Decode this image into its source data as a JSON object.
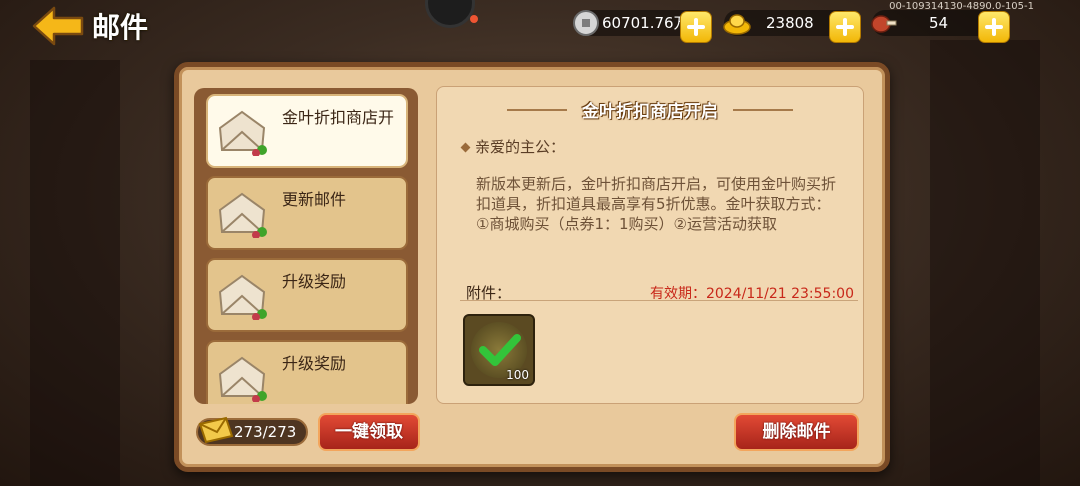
{
  "header": {
    "title": "邮件"
  },
  "debug_text": "00-109314130-4890.0-105-1",
  "resources": {
    "silver": {
      "value": "60701.76万",
      "icon": "silver-coin-icon"
    },
    "gold": {
      "value": "23808",
      "icon": "gold-ingot-icon"
    },
    "stamina": {
      "value": "54",
      "icon": "meat-icon"
    }
  },
  "mail_list": {
    "items": [
      {
        "label": "金叶折扣商店开",
        "selected": true
      },
      {
        "label": "更新邮件",
        "selected": false
      },
      {
        "label": "升级奖励",
        "selected": false
      },
      {
        "label": "升级奖励",
        "selected": false
      }
    ],
    "counter": "273/273"
  },
  "detail": {
    "title": "金叶折扣商店开启",
    "greeting": "亲爱的主公：",
    "body": "新版本更新后，金叶折扣商店开启，可使用金叶购买折扣道具，折扣道具最高享有5折优惠。金叶获取方式：①商城购买（点券1：1购买）②运营活动获取",
    "attachment_label": "附件：",
    "expire": "有效期：2024/11/21 23:55:00",
    "attachment": {
      "count": "100",
      "icon": "checkmark-icon"
    }
  },
  "buttons": {
    "claim_all": "一键领取",
    "delete_mail": "删除邮件"
  },
  "colors": {
    "accent_red": "#c8281a",
    "button_red": "#c9342a",
    "gold": "#f2b707"
  }
}
